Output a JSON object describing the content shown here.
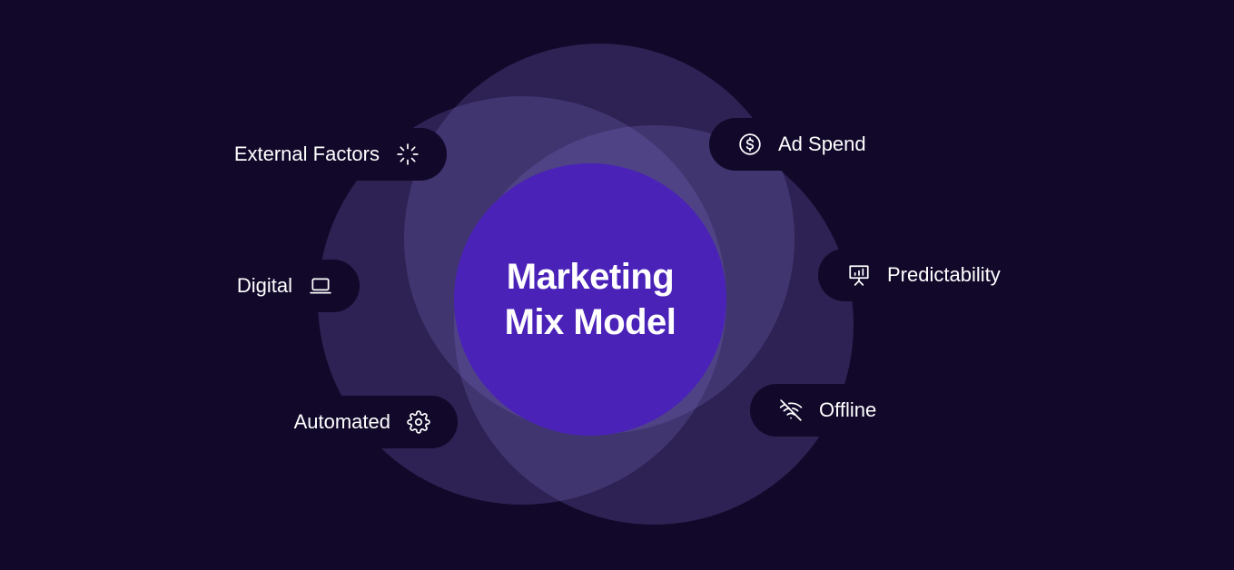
{
  "center": {
    "line1": "Marketing",
    "line2": "Mix Model"
  },
  "factors_left": [
    {
      "label": "External Factors",
      "icon": "loading-spinner-icon"
    },
    {
      "label": "Digital",
      "icon": "laptop-icon"
    },
    {
      "label": "Automated",
      "icon": "gear-icon"
    }
  ],
  "factors_right": [
    {
      "label": "Ad Spend",
      "icon": "dollar-coin-icon"
    },
    {
      "label": "Predictability",
      "icon": "presentation-chart-icon"
    },
    {
      "label": "Offline",
      "icon": "wifi-off-icon"
    }
  ],
  "colors": {
    "background": "#11082a",
    "center_circle": "#4a22b8",
    "overlap_circles": "#7869be",
    "text": "#ffffff"
  }
}
